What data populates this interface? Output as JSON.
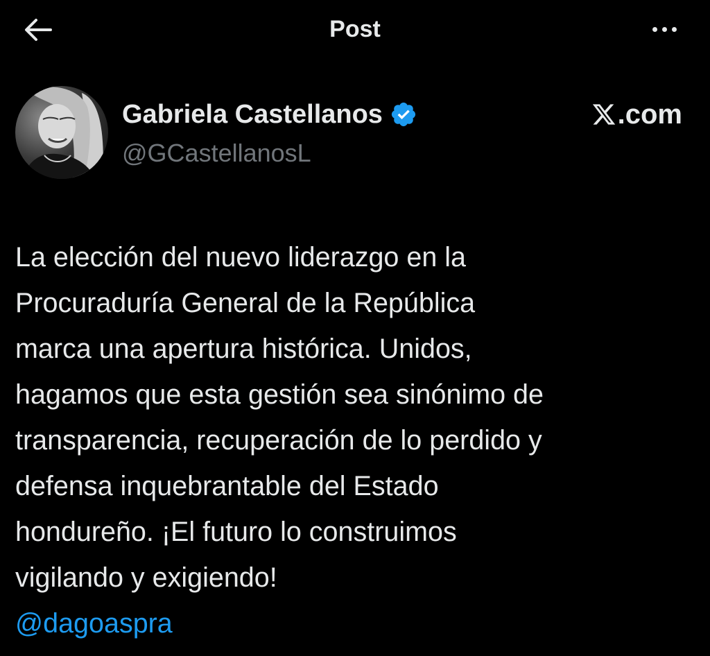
{
  "header": {
    "title": "Post",
    "back_icon": "arrow-left-icon",
    "more_icon": "more-horizontal-icon"
  },
  "author": {
    "display_name": "Gabriela Castellanos",
    "handle": "@GCastellanosL",
    "verified": true,
    "verified_icon": "verified-badge-icon",
    "verified_color": "#1d9bf0"
  },
  "brand": {
    "text": ".com",
    "logo_icon": "x-logo-icon"
  },
  "post": {
    "body": "La elección del nuevo liderazgo en la\nProcuraduría General de la República\nmarca una apertura histórica. Unidos,\nhagamos que esta gestión sea sinónimo de\ntransparencia, recuperación de lo perdido y\ndefensa inquebrantable del Estado\nhondureño. ¡El futuro lo construimos\nvigilando y exigiendo!",
    "mention": "@dagoaspra"
  },
  "colors": {
    "background": "#000000",
    "text_primary": "#e7e9ea",
    "text_secondary": "#71767b",
    "link": "#1d9bf0"
  }
}
